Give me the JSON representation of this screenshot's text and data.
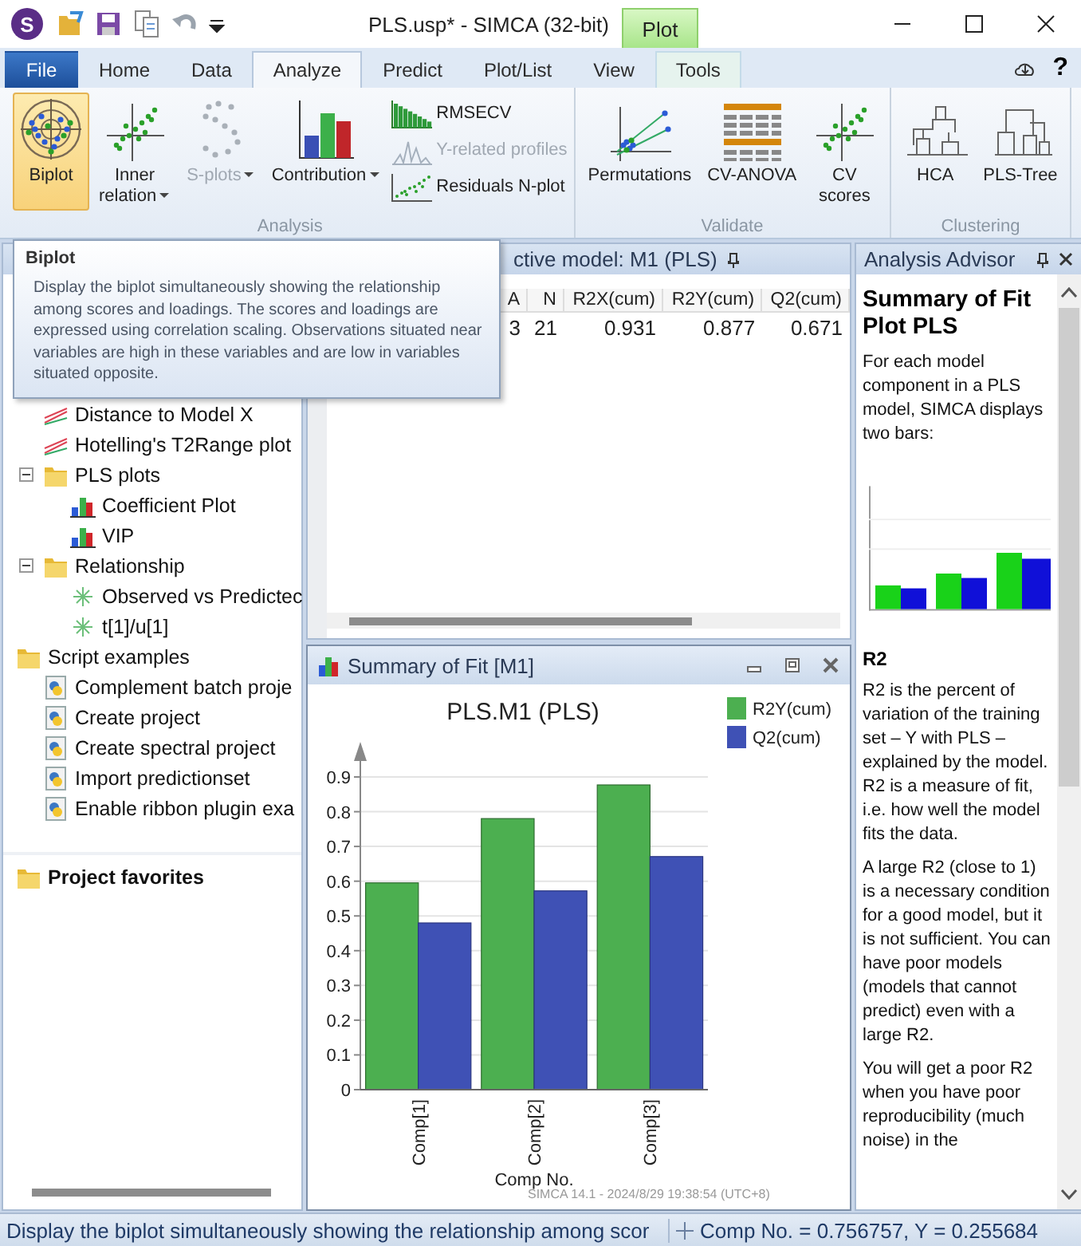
{
  "window": {
    "app_logo": "S",
    "title": "PLS.usp* - SIMCA (32-bit)",
    "contextual_tab": "Plot",
    "help": "?"
  },
  "tabs": [
    {
      "label": "File",
      "kind": "file",
      "selected": false
    },
    {
      "label": "Home",
      "kind": "normal",
      "selected": false
    },
    {
      "label": "Data",
      "kind": "normal",
      "selected": false
    },
    {
      "label": "Analyze",
      "kind": "normal",
      "selected": true
    },
    {
      "label": "Predict",
      "kind": "normal",
      "selected": false
    },
    {
      "label": "Plot/List",
      "kind": "normal",
      "selected": false
    },
    {
      "label": "View",
      "kind": "normal",
      "selected": false
    },
    {
      "label": "Tools",
      "kind": "contextual",
      "selected": false
    }
  ],
  "ribbon": {
    "groups": [
      {
        "label": "Analysis",
        "buttons": [
          {
            "label": "Biplot",
            "selected": true,
            "disabled": false,
            "dropdown": false
          },
          {
            "label": "Inner relation",
            "selected": false,
            "disabled": false,
            "dropdown": true
          },
          {
            "label": "S-plots",
            "selected": false,
            "disabled": true,
            "dropdown": true
          },
          {
            "label": "Contribution",
            "selected": false,
            "disabled": false,
            "dropdown": true
          }
        ],
        "small_buttons": [
          {
            "label": "RMSECV",
            "disabled": false
          },
          {
            "label": "Y-related profiles",
            "disabled": true
          },
          {
            "label": "Residuals N-plot",
            "disabled": false
          }
        ]
      },
      {
        "label": "Validate",
        "buttons": [
          {
            "label": "Permutations",
            "selected": false,
            "disabled": false,
            "dropdown": false
          },
          {
            "label": "CV-ANOVA",
            "selected": false,
            "disabled": false,
            "dropdown": false
          },
          {
            "label": "CV scores",
            "selected": false,
            "disabled": false,
            "dropdown": false
          }
        ]
      },
      {
        "label": "Clustering",
        "buttons": [
          {
            "label": "HCA",
            "selected": false,
            "disabled": false,
            "dropdown": false
          },
          {
            "label": "PLS-Tree",
            "selected": false,
            "disabled": false,
            "dropdown": false
          }
        ]
      }
    ]
  },
  "tooltip": {
    "title": "Biplot",
    "text": "Display the biplot simultaneously showing the relationship among scores and loadings. The scores and loadings are expressed using correlation scaling. Observations situated near variables are high in these variables and are low in variables situated opposite."
  },
  "tree": [
    {
      "children": [
        {
          "label": "Distance to Model X",
          "kind": "lineplot"
        },
        {
          "label": "Hotelling's T2Range plot",
          "kind": "lineplot"
        },
        {
          "label": "PLS plots",
          "kind": "folder",
          "expanded": true,
          "children": [
            {
              "label": "Coefficient Plot",
              "kind": "barplot"
            },
            {
              "label": "VIP",
              "kind": "barplot"
            }
          ]
        },
        {
          "label": "Relationship",
          "kind": "folder",
          "expanded": true,
          "children": [
            {
              "label": "Observed vs Predictec",
              "kind": "scatterplot"
            },
            {
              "label": "t[1]/u[1]",
              "kind": "scatterplot"
            }
          ]
        }
      ]
    },
    {
      "label": "Script examples",
      "kind": "folder",
      "children": [
        {
          "label": "Complement batch proje",
          "kind": "script"
        },
        {
          "label": "Create project",
          "kind": "script"
        },
        {
          "label": "Create spectral project",
          "kind": "script"
        },
        {
          "label": "Import predictionset",
          "kind": "script"
        },
        {
          "label": "Enable ribbon plugin exa",
          "kind": "script"
        }
      ]
    }
  ],
  "favorites": {
    "label": "Project favorites"
  },
  "model_panel": {
    "title": "ctive model: M1 (PLS)",
    "columns": [
      "A",
      "N",
      "R2X(cum)",
      "R2Y(cum)",
      "Q2(cum)"
    ],
    "rows": [
      [
        "3",
        "21",
        "0.931",
        "0.877",
        "0.671"
      ]
    ]
  },
  "plot_window": {
    "title": "Summary of Fit [M1]",
    "footer": "SIMCA 14.1 - 2024/8/29 19:38:54 (UTC+8)",
    "chart_data": {
      "type": "bar",
      "title": "PLS.M1 (PLS)",
      "xlabel": "Comp No.",
      "categories": [
        "Comp[1]",
        "Comp[2]",
        "Comp[3]"
      ],
      "series": [
        {
          "name": "R2Y(cum)",
          "color": "#4caf50",
          "values": [
            0.595,
            0.78,
            0.877
          ]
        },
        {
          "name": "Q2(cum)",
          "color": "#3f51b5",
          "values": [
            0.48,
            0.572,
            0.671
          ]
        }
      ],
      "ylim": [
        0,
        0.9
      ],
      "yticks": [
        0,
        0.1,
        0.2,
        0.3,
        0.4,
        0.5,
        0.6,
        0.7,
        0.8,
        0.9
      ],
      "grid": true
    }
  },
  "advisor": {
    "title": "Analysis Advisor",
    "heading": "Summary of Fit Plot PLS",
    "blocks": [
      {
        "kind": "paragraph",
        "text": "For each model component in a PLS model, SIMCA displays two bars:"
      },
      {
        "kind": "picture"
      },
      {
        "kind": "subheading",
        "text": "R2"
      },
      {
        "kind": "paragraph",
        "text": "R2 is the percent of variation of the training set – Y with PLS – explained by the model. R2 is a measure of fit, i.e. how well the model fits the data."
      },
      {
        "kind": "paragraph",
        "text": "A large R2 (close to 1) is a necessary condition for a good model, but it is not sufficient. You can have poor models (models that cannot predict) even with a large R2."
      },
      {
        "kind": "paragraph",
        "text": "You will get a poor R2 when you have poor reproducibility (much noise) in the"
      }
    ]
  },
  "status_bar": {
    "message": "Display the biplot simultaneously showing the relationship among scor",
    "coordinates": "Comp No. = 0.756757, Y = 0.255684"
  }
}
